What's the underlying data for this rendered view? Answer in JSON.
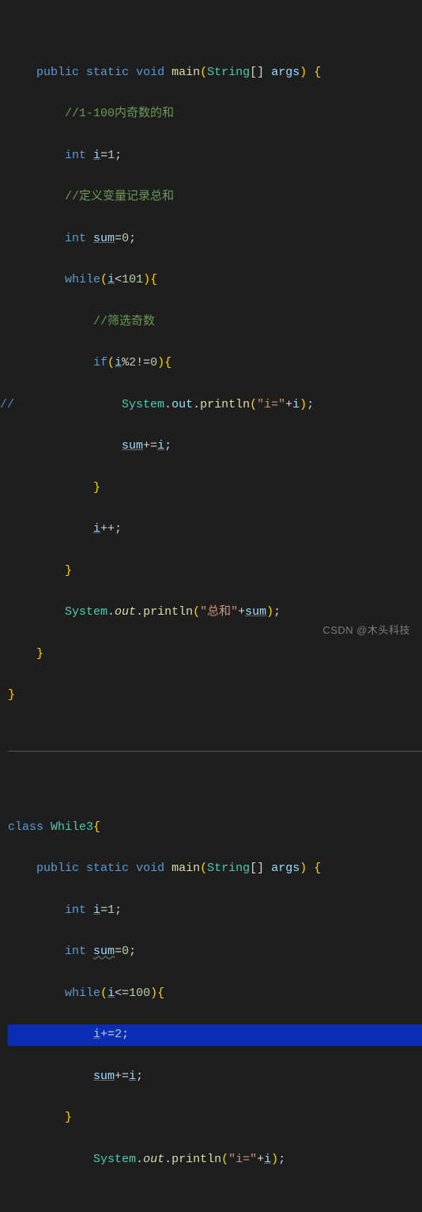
{
  "block1": {
    "sig_kw1": "public",
    "sig_kw2": "static",
    "sig_kw3": "void",
    "sig_fn": "main",
    "sig_type": "String",
    "sig_arr": "[]",
    "sig_arg": "args",
    "c1": "//1-100内奇数的和",
    "decl1_type": "int",
    "decl1_var": "i",
    "decl1_val": "1",
    "c2": "//定义变量记录总和",
    "decl2_type": "int",
    "decl2_var": "sum",
    "decl2_val": "0",
    "while_kw": "while",
    "while_var": "i",
    "while_op": "<",
    "while_num": "101",
    "c3": "//筛选奇数",
    "if_kw": "if",
    "if_var": "i",
    "if_op1": "%",
    "if_num1": "2",
    "if_op2": "!=",
    "if_num2": "0",
    "gutter_comment": "//",
    "print1_cls": "System",
    "print1_out": "out",
    "print1_fn": "println",
    "print1_str": "\"i=\"",
    "print1_plus": "+",
    "print1_var": "i",
    "sumadd_var": "sum",
    "sumadd_op": "+=",
    "sumadd_rhs": "i",
    "inc_var": "i",
    "inc_op": "++",
    "print2_cls": "System",
    "print2_out": "out",
    "print2_fn": "println",
    "print2_str": "\"总和\"",
    "print2_plus": "+",
    "print2_var": "sum"
  },
  "block2": {
    "class_kw": "class",
    "class_name": "While3",
    "sig_kw1": "public",
    "sig_kw2": "static",
    "sig_kw3": "void",
    "sig_fn": "main",
    "sig_type": "String",
    "sig_arr": "[]",
    "sig_arg": "args",
    "decl1_type": "int",
    "decl1_var": "i",
    "decl1_val": "1",
    "decl2_type": "int",
    "decl2_var": "sum",
    "decl2_val": "0",
    "while_kw": "while",
    "while_var": "i",
    "while_op": "<=",
    "while_num": "100",
    "step_var": "i",
    "step_op": "+=",
    "step_val": "2",
    "sumadd_var": "sum",
    "sumadd_op": "+=",
    "sumadd_rhs": "i",
    "print_cls": "System",
    "print_out": "out",
    "print_fn": "println",
    "print_str": "\"i=\"",
    "print_plus": "+",
    "print_var": "i"
  },
  "watermark": "CSDN @木头科技"
}
